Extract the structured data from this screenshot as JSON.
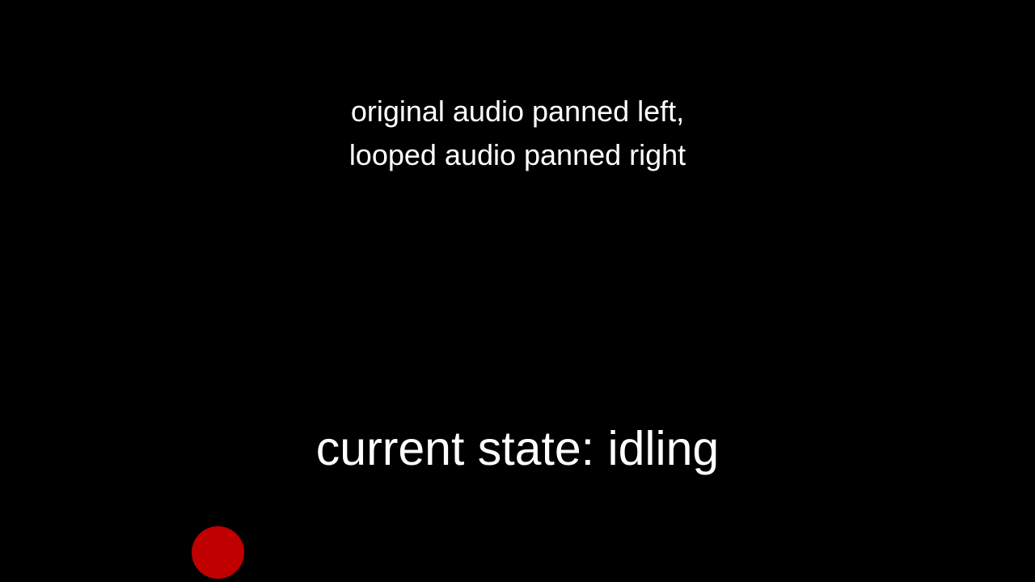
{
  "caption": {
    "line1": "original audio panned left,",
    "line2": "looped audio panned right"
  },
  "status": {
    "text": "current state: idling"
  },
  "indicator": {
    "icon": "record-dot-icon",
    "color": "#c00000"
  },
  "colors": {
    "background": "#000000",
    "text": "#ffffff"
  }
}
